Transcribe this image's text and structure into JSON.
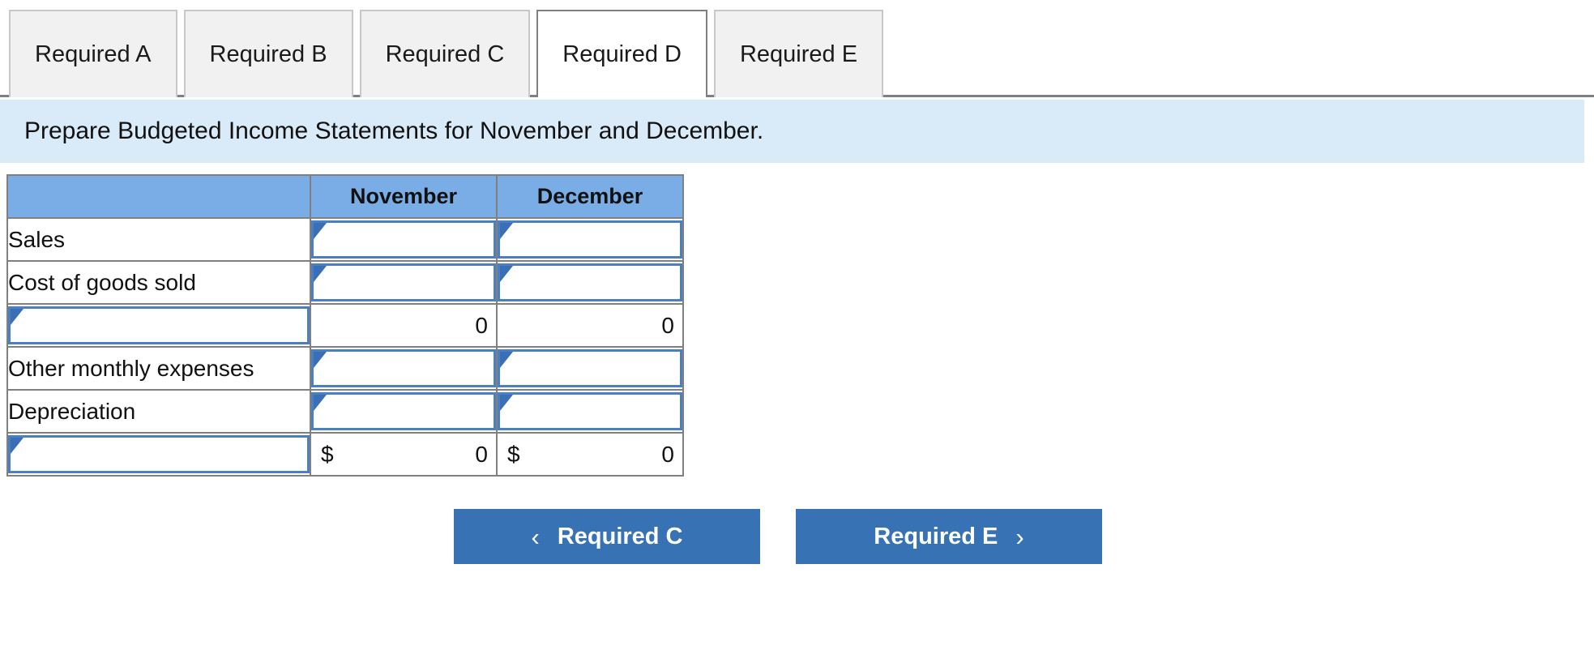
{
  "tabs": [
    {
      "label": "Required A",
      "active": false
    },
    {
      "label": "Required B",
      "active": false
    },
    {
      "label": "Required C",
      "active": false
    },
    {
      "label": "Required D",
      "active": true
    },
    {
      "label": "Required E",
      "active": false
    }
  ],
  "banner": {
    "instruction": "Prepare Budgeted Income Statements for November and December."
  },
  "table": {
    "headers": [
      "",
      "November",
      "December"
    ],
    "rows": [
      {
        "type": "input",
        "label": "Sales",
        "label_kind": "text",
        "november": "",
        "december": ""
      },
      {
        "type": "input",
        "label": "Cost of goods sold",
        "label_kind": "text",
        "november": "",
        "december": ""
      },
      {
        "type": "result",
        "label": "",
        "label_kind": "input",
        "november": "0",
        "december": "0",
        "currency": "",
        "rule": "top"
      },
      {
        "type": "input",
        "label": "Other monthly expenses",
        "label_kind": "text",
        "november": "",
        "december": ""
      },
      {
        "type": "input",
        "label": "Depreciation",
        "label_kind": "text",
        "november": "",
        "december": ""
      },
      {
        "type": "result",
        "label": "",
        "label_kind": "input",
        "november": "0",
        "december": "0",
        "currency": "$",
        "rule": "total"
      }
    ]
  },
  "nav": {
    "prev_label": "Required C",
    "next_label": "Required E",
    "prev_chevron": "‹",
    "next_chevron": "›"
  },
  "colors": {
    "header_blue": "#7aade5",
    "banner_blue": "#d9ebf8",
    "button_blue": "#3773b4",
    "input_border": "#4a7fc1",
    "marker_blue": "#3b6fb5",
    "grid_gray": "#808080"
  }
}
